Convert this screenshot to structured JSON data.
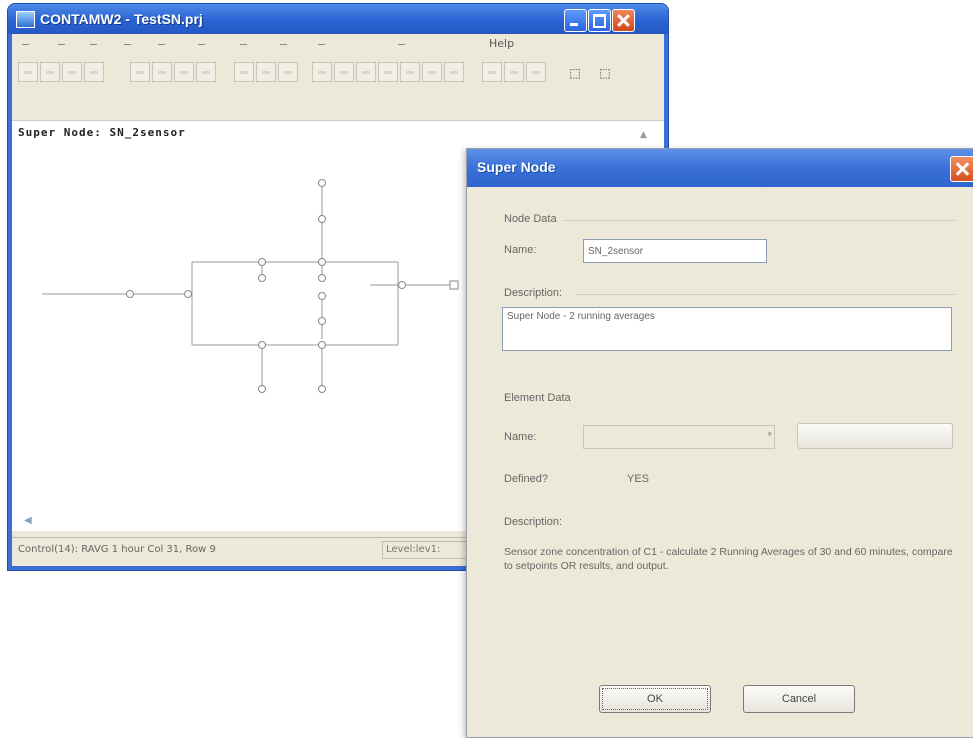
{
  "main_window": {
    "title": "CONTAMW2 - TestSN.prj",
    "menu": {
      "help_label": "Help"
    },
    "super_node_label": "Super Node:  SN_2sensor",
    "status": {
      "text": "Control(14): RAVG 1 hour   Col 31, Row 9",
      "level": "Level:lev1:"
    }
  },
  "dialog": {
    "title": "Super Node",
    "node_data": {
      "section_label": "Node Data",
      "name_label": "Name:",
      "name_value": "SN_2sensor",
      "description_label": "Description:",
      "description_value": "Super Node - 2 running averages"
    },
    "element_data": {
      "section_label": "Element Data",
      "name_label": "Name:",
      "defined_label": "Defined?",
      "defined_value": "YES",
      "description_label": "Description:",
      "description_value": "Sensor zone concentration of C1 - calculate 2 Running Averages of 30 and 60 minutes, compare to setpoints OR results, and output."
    },
    "buttons": {
      "ok": "OK",
      "cancel": "Cancel"
    }
  }
}
